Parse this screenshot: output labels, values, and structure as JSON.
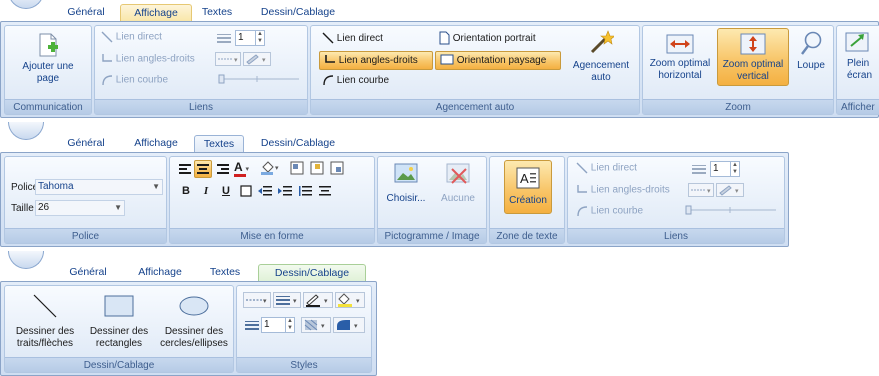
{
  "ribbon1": {
    "tabs": [
      "Général",
      "Affichage",
      "Textes",
      "Dessin/Cablage"
    ],
    "active_tab": "Affichage",
    "communication": {
      "add_page": "Ajouter une page",
      "title": "Communication"
    },
    "liens": {
      "direct": "Lien direct",
      "angles": "Lien angles-droits",
      "courbe": "Lien courbe",
      "spin_value": "1",
      "title": "Liens"
    },
    "agencement": {
      "direct": "Lien direct",
      "angles": "Lien angles-droits",
      "courbe": "Lien courbe",
      "portrait": "Orientation portrait",
      "paysage": "Orientation paysage",
      "auto": "Agencement auto",
      "title": "Agencement auto"
    },
    "zoom": {
      "horizontal": "Zoom optimal horizontal",
      "vertical": "Zoom optimal vertical",
      "loupe": "Loupe",
      "title": "Zoom"
    },
    "afficher": {
      "plein_ecran": "Plein écran",
      "title": "Afficher"
    }
  },
  "ribbon2": {
    "tabs": [
      "Général",
      "Affichage",
      "Textes",
      "Dessin/Cablage"
    ],
    "active_tab": "Textes",
    "police": {
      "police_label": "Police",
      "police_value": "Tahoma",
      "taille_label": "Taille",
      "taille_value": "26",
      "title": "Police"
    },
    "mise_en_forme": {
      "bold": "B",
      "italic": "I",
      "underline": "U",
      "font_color": "A",
      "title": "Mise en forme"
    },
    "pictogramme": {
      "choisir": "Choisir...",
      "aucune": "Aucune",
      "title": "Pictogramme / Image"
    },
    "zone_texte": {
      "creation": "Création",
      "title": "Zone de texte"
    },
    "liens": {
      "direct": "Lien direct",
      "angles": "Lien angles-droits",
      "courbe": "Lien courbe",
      "spin_value": "1",
      "title": "Liens"
    }
  },
  "ribbon3": {
    "tabs": [
      "Général",
      "Affichage",
      "Textes",
      "Dessin/Cablage"
    ],
    "active_tab": "Dessin/Cablage",
    "dessin": {
      "traits": "Dessiner des traits/flèches",
      "rectangles": "Dessiner des rectangles",
      "cercles": "Dessiner des cercles/ellipses",
      "title": "Dessin/Cablage"
    },
    "styles": {
      "spin_value": "1",
      "title": "Styles"
    }
  },
  "colors": {
    "accent": "#15428b",
    "active_orange": "#f8c66a",
    "ribbon_bg": "#dbe6f4"
  }
}
